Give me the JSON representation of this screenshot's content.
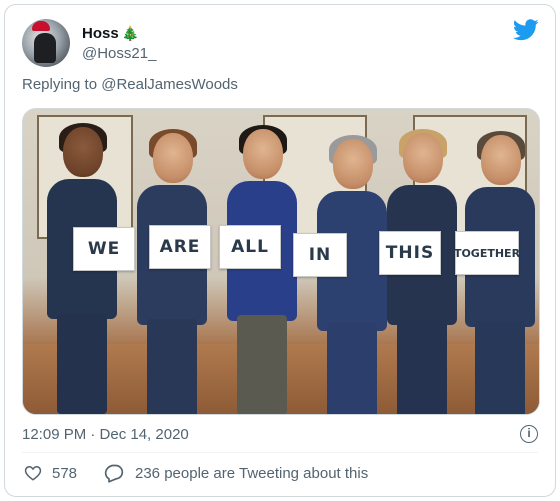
{
  "tweet": {
    "author_name": "Hoss",
    "author_emoji": "🎄",
    "author_handle": "@Hoss21_",
    "replying_prefix": "Replying to ",
    "replying_to": "@RealJamesWoods",
    "timestamp": "12:09 PM · Dec 14, 2020",
    "like_count": "578",
    "tweeting_text": "236 people are Tweeting about this",
    "info_glyph": "i"
  },
  "photo": {
    "signs": [
      "WE",
      "ARE",
      "ALL",
      "IN",
      "THIS",
      "TOGETHER"
    ]
  },
  "icons": {
    "brand": "twitter-bird-icon",
    "info": "info-icon",
    "like": "heart-icon",
    "reply": "reply-bubble-icon"
  },
  "colors": {
    "brand_blue": "#1d9bf0",
    "secondary_text": "#536471",
    "primary_text": "#0f1419",
    "border": "#cfd9de"
  }
}
